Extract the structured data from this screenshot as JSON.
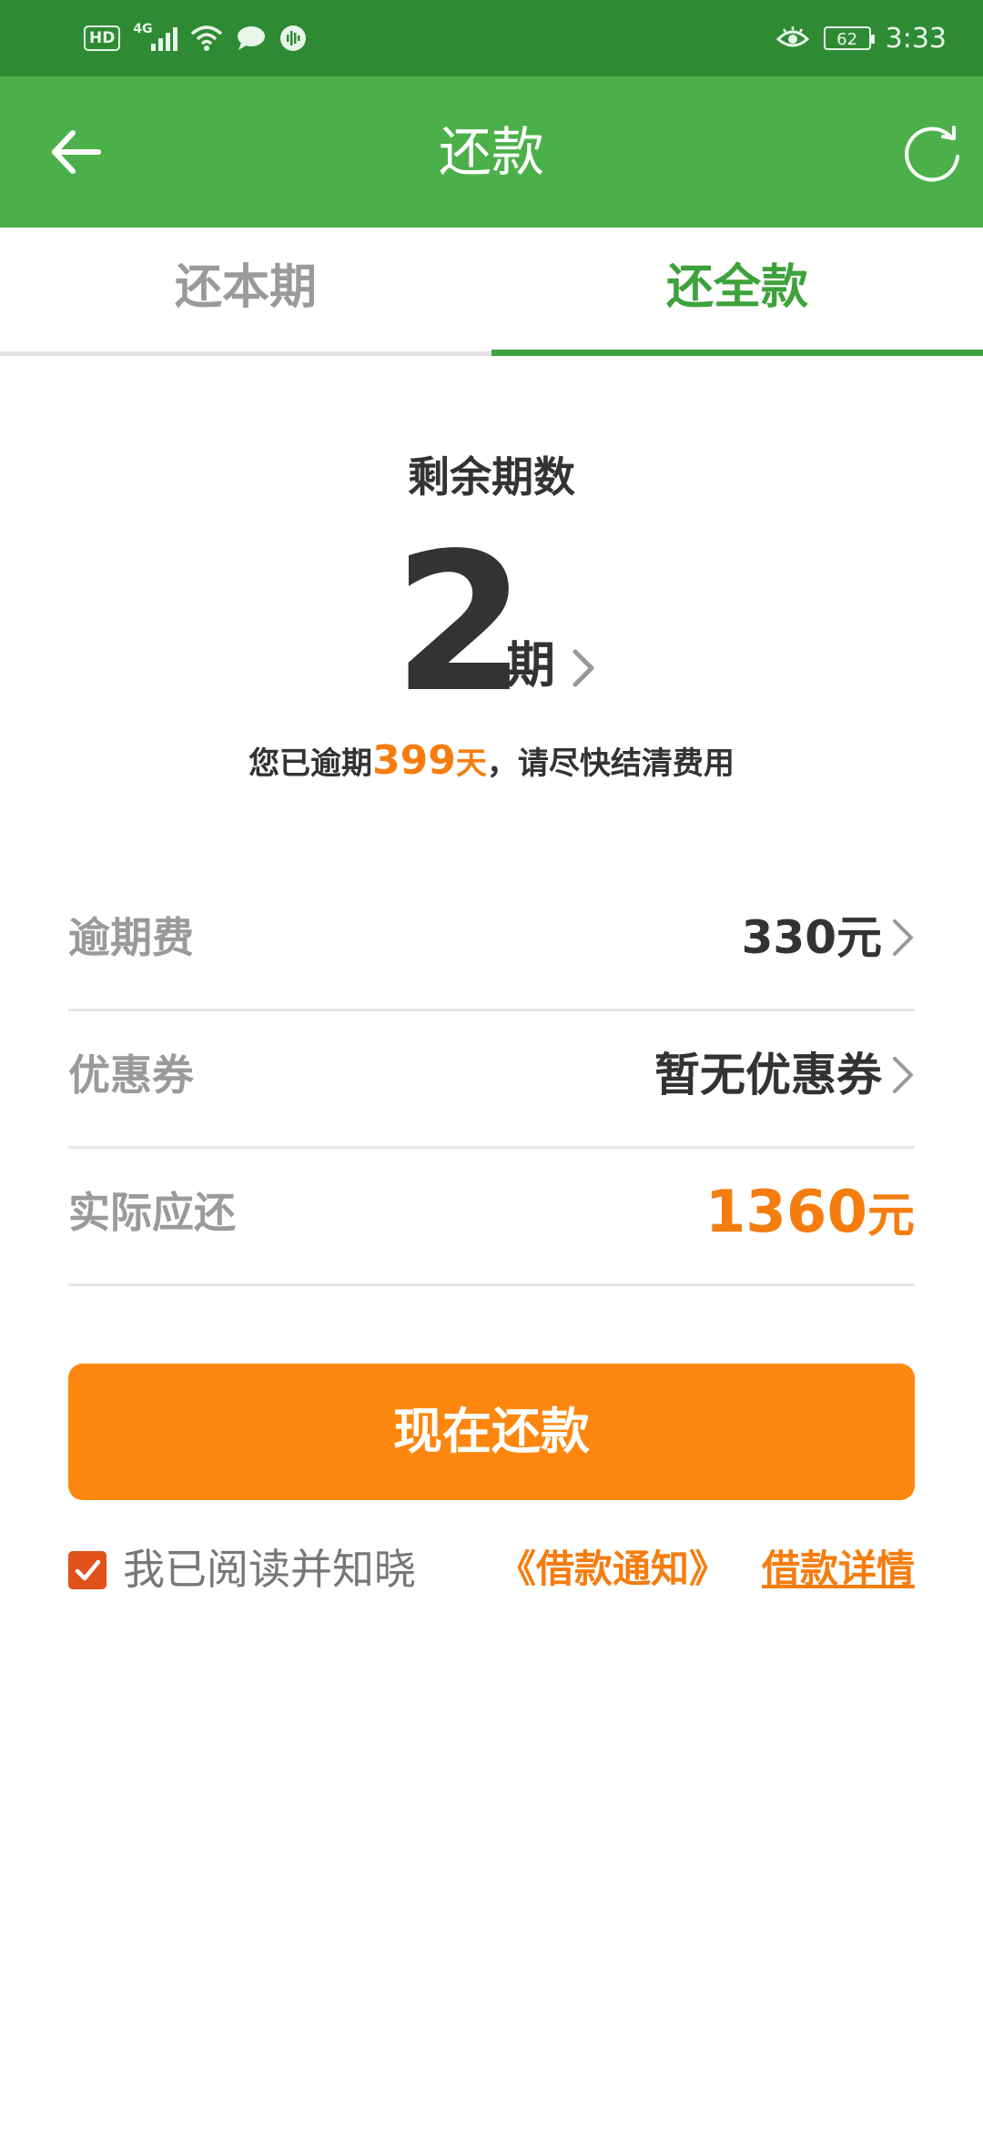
{
  "status_bar": {
    "hd": "HD",
    "network": "4G",
    "battery": "62",
    "time": "3:33"
  },
  "header": {
    "title": "还款",
    "back_icon": "back-arrow-icon",
    "refresh_icon": "refresh-icon"
  },
  "tabs": [
    {
      "label": "还本期",
      "active": false
    },
    {
      "label": "还全款",
      "active": true
    }
  ],
  "remaining": {
    "label": "剩余期数",
    "count": "2",
    "unit": "期"
  },
  "overdue": {
    "prefix": "您已逾期",
    "days": "399",
    "days_unit": "天",
    "suffix": "，请尽快结清费用"
  },
  "rows": {
    "late_fee": {
      "label": "逾期费",
      "value": "330元"
    },
    "coupon": {
      "label": "优惠券",
      "value": "暂无优惠券"
    },
    "actual_due": {
      "label": "实际应还",
      "amount": "1360",
      "unit": "元"
    }
  },
  "pay_button": {
    "label": "现在还款"
  },
  "agreement": {
    "checked": true,
    "text": "我已阅读并知晓",
    "link": "《借款通知》",
    "detail_link": "借款详情"
  },
  "colors": {
    "status_bar": "#2e8b34",
    "header": "#4cb04a",
    "tab_active": "#3da23b",
    "accent_orange": "#f57d10",
    "button": "#fd870e",
    "checkbox": "#e0521a"
  }
}
